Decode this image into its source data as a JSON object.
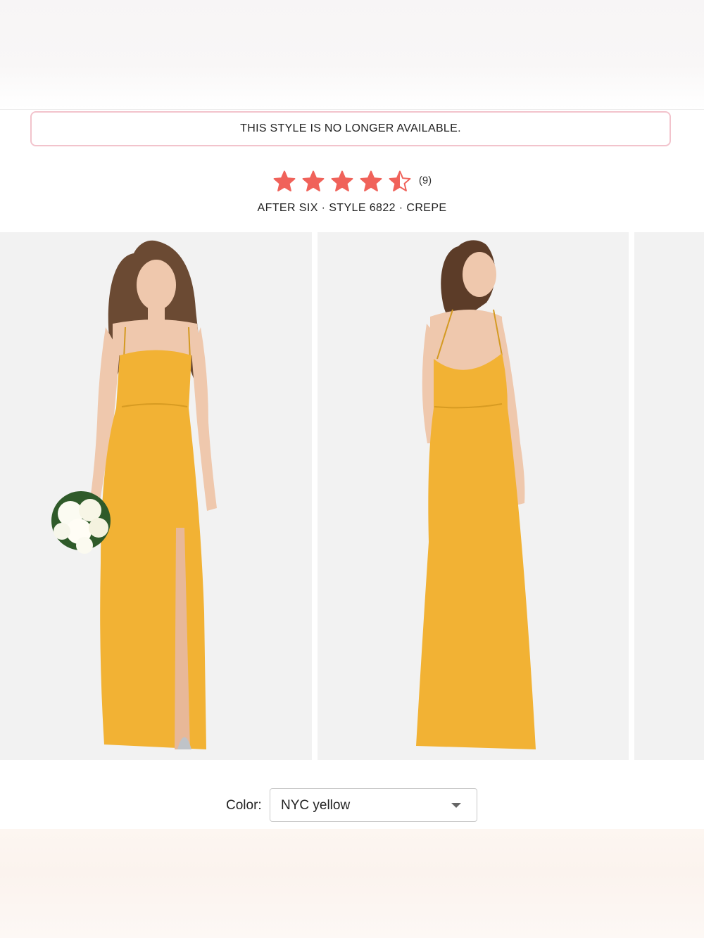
{
  "notice": {
    "text": "THIS STYLE IS NO LONGER AVAILABLE."
  },
  "rating": {
    "value": 4.5,
    "max": 5,
    "review_count": "(9)",
    "star_color": "#f0625a"
  },
  "product": {
    "subtitle": "AFTER SIX · STYLE 6822 · CREPE"
  },
  "gallery": {
    "images": [
      {
        "icon": "front-view-photo",
        "dress_color": "#f2b234"
      },
      {
        "icon": "back-view-photo",
        "dress_color": "#f2b234"
      },
      {
        "icon": "partial-photo",
        "dress_color": "#f2b234"
      }
    ]
  },
  "color_selector": {
    "label": "Color:",
    "value": "NYC yellow"
  }
}
